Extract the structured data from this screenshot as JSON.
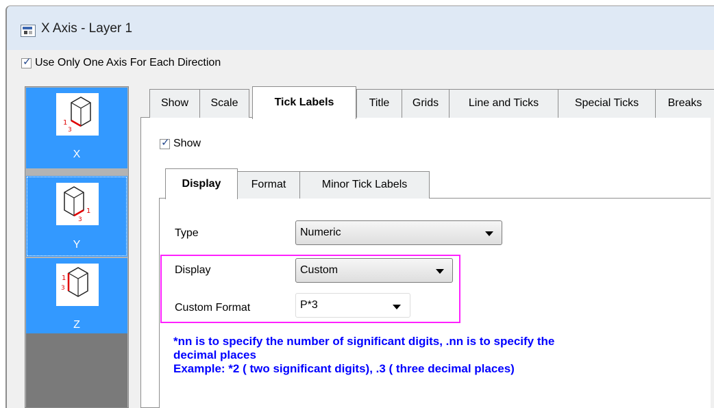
{
  "window": {
    "title": "X Axis - Layer 1",
    "title_icon": "window-app-icon"
  },
  "use_one_axis": {
    "label": "Use Only One Axis For Each Direction",
    "checked": true
  },
  "axes": [
    {
      "label": "X",
      "icon": "cube-x-axis-icon",
      "selected": false
    },
    {
      "label": "Y",
      "icon": "cube-y-axis-icon",
      "selected": true
    },
    {
      "label": "Z",
      "icon": "cube-z-axis-icon",
      "selected": false
    }
  ],
  "thumb_marks": {
    "x": "1",
    "y": "1",
    "z": "1",
    "sub": "3"
  },
  "tabs": [
    "Show",
    "Scale",
    "Tick Labels",
    "Title",
    "Grids",
    "Line and Ticks",
    "Special Ticks",
    "Breaks"
  ],
  "active_tab": "Tick Labels",
  "show": {
    "label": "Show",
    "checked": true
  },
  "subtabs": [
    "Display",
    "Format",
    "Minor Tick Labels"
  ],
  "active_subtab": "Display",
  "form": {
    "type_label": "Type",
    "type_value": "Numeric",
    "display_label": "Display",
    "display_value": "Custom",
    "custom_format_label": "Custom Format",
    "custom_format_value": "P*3"
  },
  "note": {
    "line1": "*nn is to specify the number of significant digits, .nn is to specify the",
    "line2": "decimal places",
    "line3": "Example: *2 ( two significant digits), .3 ( three decimal places)"
  },
  "colors": {
    "selection_blue": "#3399ff",
    "highlight_magenta": "#ff20ff",
    "note_blue": "#0000ff"
  }
}
